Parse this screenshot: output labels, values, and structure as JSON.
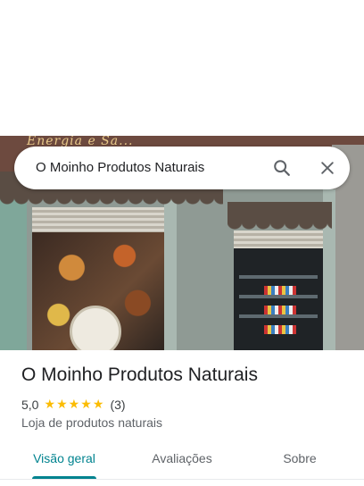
{
  "search": {
    "query": "O Moinho Produtos Naturais",
    "search_icon": "search-icon",
    "close_icon": "close-icon"
  },
  "photo": {
    "sign_text": "Energia e Sa..."
  },
  "place": {
    "title": "O Moinho Produtos Naturais",
    "rating": "5,0",
    "stars": 5,
    "review_count": "(3)",
    "category": "Loja de produtos naturais"
  },
  "tabs": [
    {
      "label": "Visão geral",
      "active": true
    },
    {
      "label": "Avaliações",
      "active": false
    },
    {
      "label": "Sobre",
      "active": false
    }
  ],
  "colors": {
    "accent": "#00838f",
    "star": "#fbbc04",
    "text_primary": "#202124",
    "text_secondary": "#5f6368"
  }
}
